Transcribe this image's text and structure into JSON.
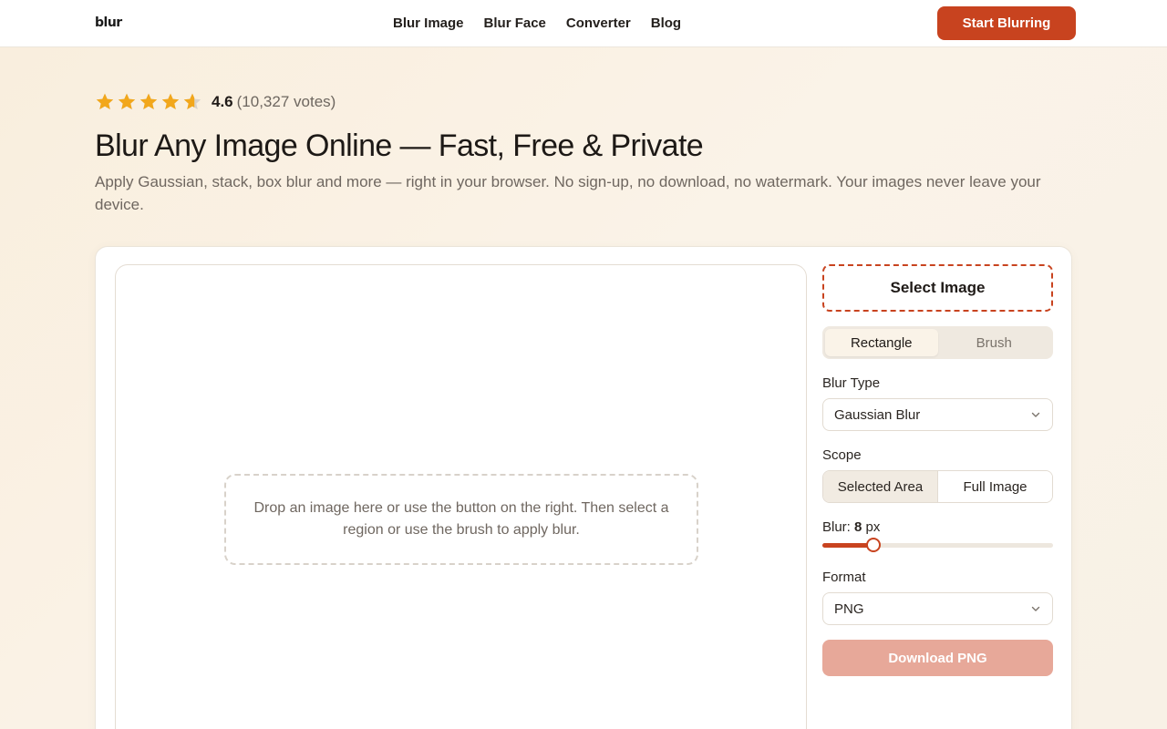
{
  "header": {
    "logo": "blur",
    "nav": [
      "Blur Image",
      "Blur Face",
      "Converter",
      "Blog"
    ],
    "cta_label": "Start Blurring"
  },
  "rating": {
    "stars": 4.6,
    "score": "4.6",
    "votes": "(10,327 votes)"
  },
  "hero": {
    "title": "Blur Any Image Online — Fast, Free & Private",
    "subtitle": "Apply Gaussian, stack, box blur and more — right in your browser. No sign-up, no download, no watermark. Your images never leave your device."
  },
  "canvas": {
    "drop_text": "Drop an image here or use the button on the right. Then select a region or use the brush to apply blur."
  },
  "panel": {
    "select_image_label": "Select Image",
    "mode_tabs": [
      "Rectangle",
      "Brush"
    ],
    "active_mode": "Rectangle",
    "blur_type_label": "Blur Type",
    "blur_type_value": "Gaussian Blur",
    "scope_label": "Scope",
    "scope_options": [
      "Selected Area",
      "Full Image"
    ],
    "active_scope": "Selected Area",
    "blur_prefix": "Blur:",
    "blur_value": "8",
    "blur_unit": "px",
    "blur_fraction": 0.22,
    "format_label": "Format",
    "format_value": "PNG",
    "download_label": "Download PNG"
  },
  "colors": {
    "accent": "#c8431f",
    "star": "#f2a71b",
    "disabled_button": "#e7a899"
  }
}
